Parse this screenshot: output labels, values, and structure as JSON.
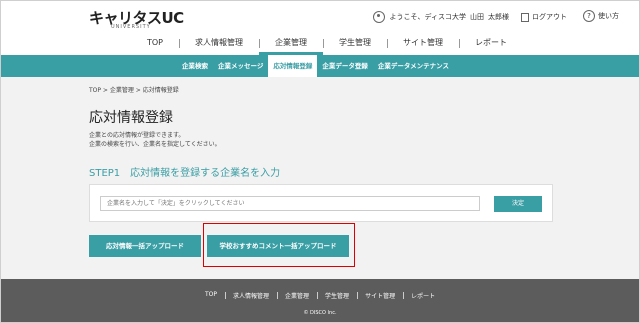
{
  "header": {
    "logo": "キャリタスUC",
    "logo_sub": "UNIVERSITY",
    "greeting": "ようこそ、ディスコ大学",
    "user_last": "山田",
    "user_first": "太郎様",
    "logout": "ログアウト",
    "help": "使い方"
  },
  "mainnav": [
    "TOP",
    "求人情報管理",
    "企業管理",
    "学生管理",
    "サイト管理",
    "レポート"
  ],
  "subnav": [
    "企業検索",
    "企業メッセージ",
    "応対情報登録",
    "企業データ登録",
    "企業データメンテナンス"
  ],
  "breadcrumb": "TOP > 企業管理 > 応対情報登録",
  "page_title": "応対情報登録",
  "desc_line1": "企業との応対情報が登録できます。",
  "desc_line2": "企業の検索を行い、企業名を指定してください。",
  "step_title": "STEP1　応対情報を登録する企業名を入力",
  "search": {
    "placeholder": "企業名を入力して「決定」をクリックしてください",
    "button": "決定"
  },
  "buttons": {
    "bulk_upload": "応対情報一括アップロード",
    "comment_upload": "学校おすすめコメント一括アップロード"
  },
  "footer": {
    "links": [
      "TOP",
      "求人情報管理",
      "企業管理",
      "学生管理",
      "サイト管理",
      "レポート"
    ],
    "copyright": "© DISCO Inc."
  },
  "colors": {
    "accent": "#3a9ea5",
    "footer_bg": "#5c5c5c",
    "highlight": "#dd0000"
  }
}
